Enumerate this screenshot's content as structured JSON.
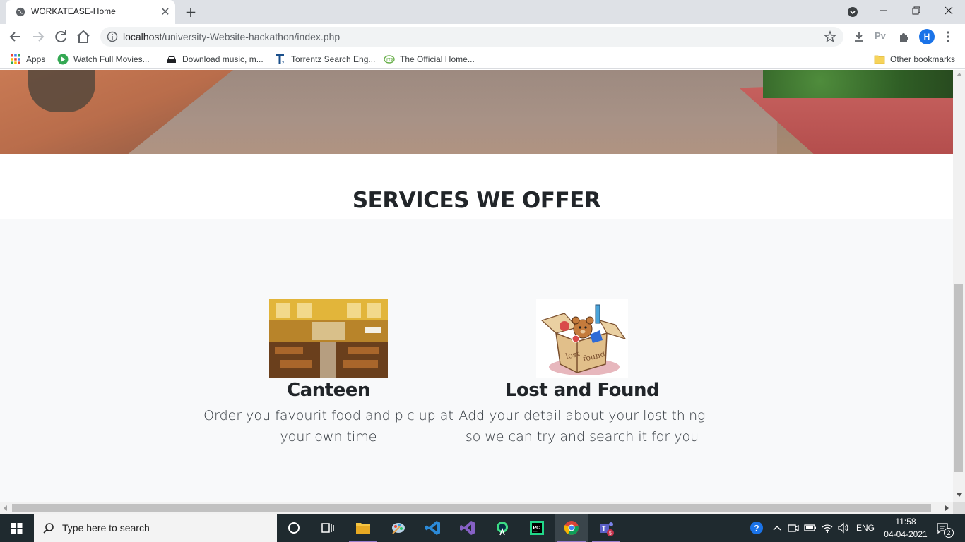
{
  "browser": {
    "tab": {
      "title": "WORKATEASE-Home",
      "close_glyph": "✕",
      "favicon": "globe-icon"
    },
    "new_tab_glyph": "+",
    "address": {
      "host": "localhost",
      "path": "/university-Website-hackathon/index.php"
    },
    "profile_initial": "H",
    "pv_label": "Pv",
    "bookmarks": [
      {
        "label": "Apps",
        "icon": "apps-grid-icon"
      },
      {
        "label": "Watch Full Movies...",
        "icon": "play-icon"
      },
      {
        "label": "Download music, m...",
        "icon": "car-icon"
      },
      {
        "label": "Torrentz Search Eng...",
        "icon": "torrentz-icon"
      },
      {
        "label": "The Official Home...",
        "icon": "yts-icon"
      }
    ],
    "other_bookmarks": "Other bookmarks"
  },
  "page": {
    "services_title": "SERVICES WE OFFER",
    "services": [
      {
        "name": "Canteen",
        "desc_line1": "Order you favourit food and pic up at",
        "desc_line2": "your own time",
        "image": "canteen-photo"
      },
      {
        "name": "Lost and Found",
        "desc_line1": "Add your detail about your lost thing",
        "desc_line2": "so we can try and search it for you",
        "image": "lost-and-found-box"
      }
    ]
  },
  "taskbar": {
    "search_placeholder": "Type here to search",
    "language": "ENG",
    "time": "11:58",
    "date": "04-04-2021",
    "notification_count": "2",
    "teams_badge": "5"
  },
  "colors": {
    "accent_blue": "#1a73e8",
    "page_text": "#212529",
    "section_bg": "#f8f9fa",
    "taskbar_bg": "#1f2a2f"
  }
}
